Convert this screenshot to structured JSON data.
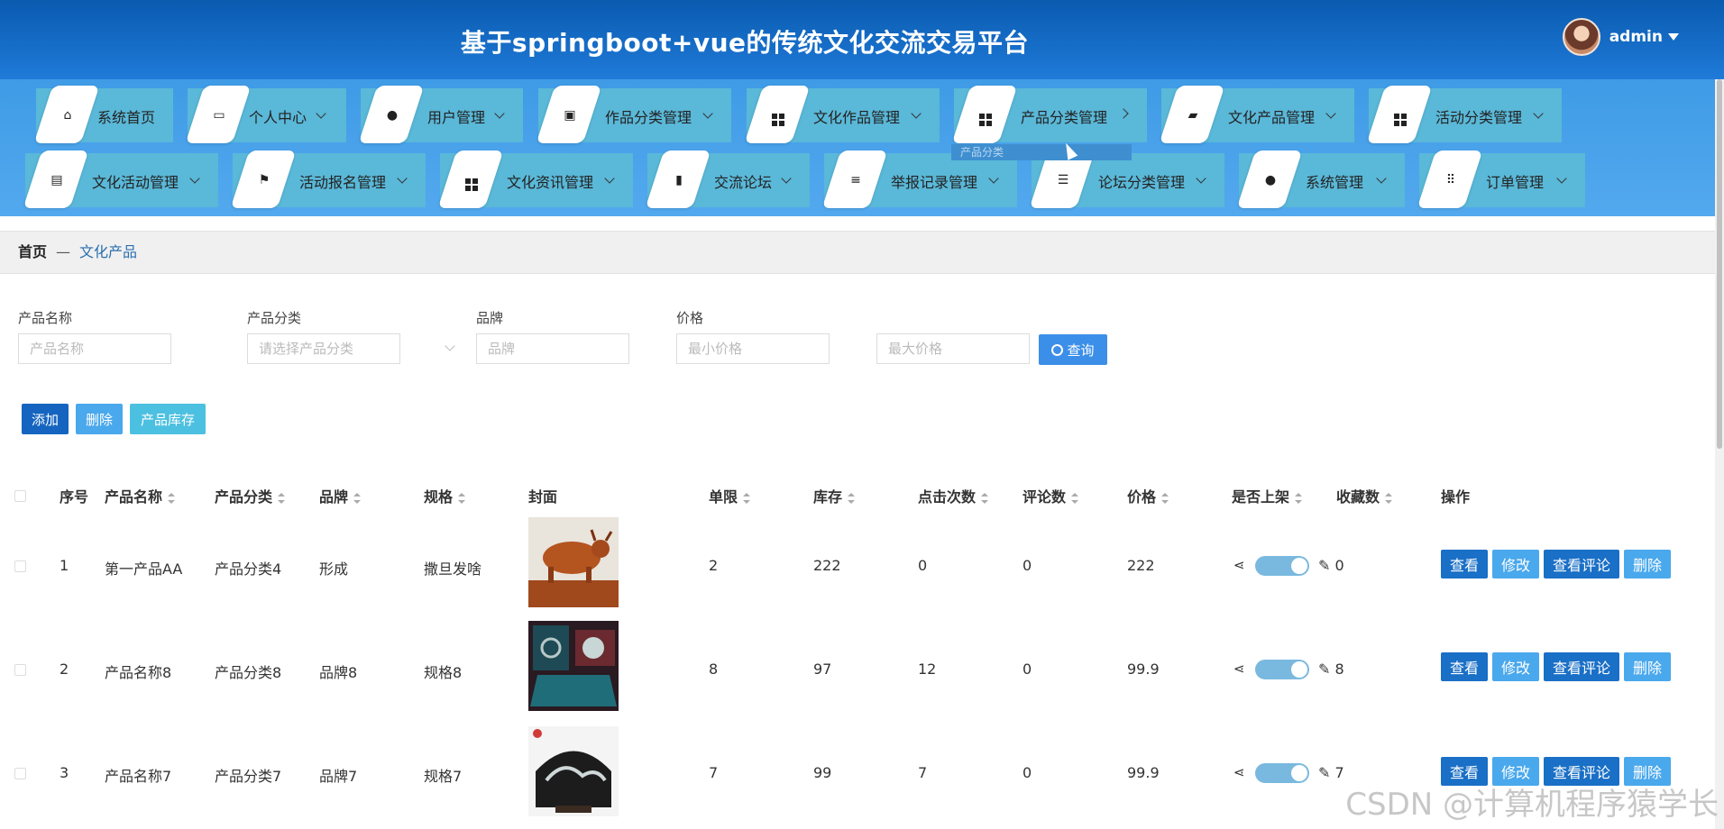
{
  "header": {
    "title": "基于springboot+vue的传统文化交流交易平台",
    "user": "admin"
  },
  "nav_row1": [
    {
      "label": "系统首页",
      "icon": "home-icon"
    },
    {
      "label": "个人中心",
      "icon": "card-icon"
    },
    {
      "label": "用户管理",
      "icon": "user-icon"
    },
    {
      "label": "作品分类管理",
      "icon": "briefcase-icon"
    },
    {
      "label": "文化作品管理",
      "icon": "grid-icon"
    },
    {
      "label": "产品分类管理",
      "icon": "grid-icon"
    },
    {
      "label": "文化产品管理",
      "icon": "wallet-icon"
    },
    {
      "label": "活动分类管理",
      "icon": "grid-icon"
    }
  ],
  "nav_row2": [
    {
      "label": "文化活动管理",
      "icon": "clipboard-icon"
    },
    {
      "label": "活动报名管理",
      "icon": "flag-icon"
    },
    {
      "label": "文化资讯管理",
      "icon": "grid-icon"
    },
    {
      "label": "交流论坛",
      "icon": "book-icon"
    },
    {
      "label": "举报记录管理",
      "icon": "list-icon"
    },
    {
      "label": "论坛分类管理",
      "icon": "sliders-icon"
    },
    {
      "label": "系统管理",
      "icon": "bulb-icon"
    },
    {
      "label": "订单管理",
      "icon": "apps-icon"
    }
  ],
  "tooltip": "产品分类",
  "breadcrumb": {
    "home": "首页",
    "sep": "—",
    "current": "文化产品"
  },
  "filters": {
    "name_label": "产品名称",
    "name_placeholder": "产品名称",
    "cat_label": "产品分类",
    "cat_placeholder": "请选择产品分类",
    "brand_label": "品牌",
    "brand_placeholder": "品牌",
    "price_label": "价格",
    "min_placeholder": "最小价格",
    "max_placeholder": "最大价格",
    "search": "查询"
  },
  "toolbar": {
    "add": "添加",
    "delete": "删除",
    "stock": "产品库存"
  },
  "columns": [
    "序号",
    "产品名称",
    "产品分类",
    "品牌",
    "规格",
    "封面",
    "单限",
    "库存",
    "点击次数",
    "评论数",
    "价格",
    "是否上架",
    "收藏数",
    "操作"
  ],
  "rows": [
    {
      "no": "1",
      "name": "第一产品AA",
      "cat": "产品分类4",
      "brand": "形成",
      "spec": "撒旦发啥",
      "limit": "2",
      "stock": "222",
      "clicks": "0",
      "comments": "0",
      "price": "222",
      "fav": "0"
    },
    {
      "no": "2",
      "name": "产品名称8",
      "cat": "产品分类8",
      "brand": "品牌8",
      "spec": "规格8",
      "limit": "8",
      "stock": "97",
      "clicks": "12",
      "comments": "0",
      "price": "99.9",
      "fav": "8"
    },
    {
      "no": "3",
      "name": "产品名称7",
      "cat": "产品分类7",
      "brand": "品牌7",
      "spec": "规格7",
      "limit": "7",
      "stock": "99",
      "clicks": "7",
      "comments": "0",
      "price": "99.9",
      "fav": "7"
    }
  ],
  "row_ops": {
    "view": "查看",
    "edit": "修改",
    "reviews": "查看评论",
    "delete": "删除"
  },
  "watermark": "CSDN @计算机程序猿学长",
  "colors": {
    "header": "#0a5bb0",
    "nav": "#53a9ee",
    "tile": "#5ab8d8",
    "primary": "#1a6fc6",
    "light": "#4aa8ec"
  }
}
